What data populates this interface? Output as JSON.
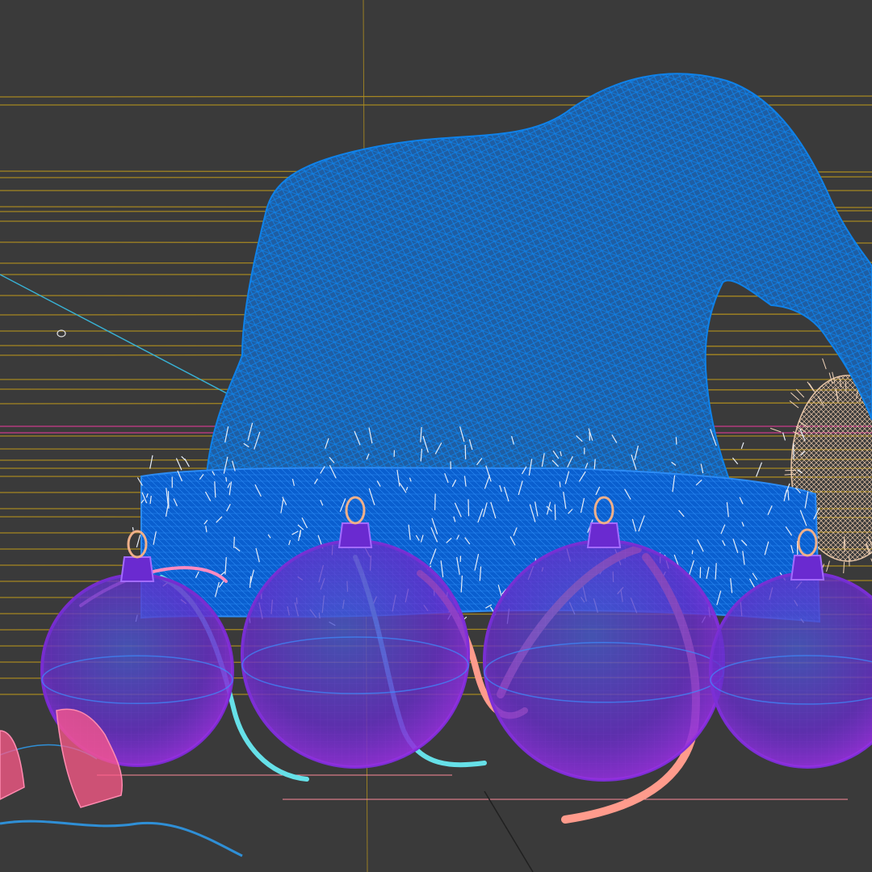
{
  "viewport": {
    "view_mode": "wireframe",
    "background_color": "#3a3a3a"
  },
  "scene": {
    "objects": [
      {
        "name": "santa-hat",
        "color": "#0a63c8"
      },
      {
        "name": "hat-fur-brim",
        "color": "#0a5fcf"
      },
      {
        "name": "ornament-ball-1",
        "color": "#7a2ccf"
      },
      {
        "name": "ornament-ball-2",
        "color": "#7b2fd4"
      },
      {
        "name": "ornament-ball-3",
        "color": "#7b2fd4"
      },
      {
        "name": "ornament-ball-4",
        "color": "#7b2fd4"
      },
      {
        "name": "ornament-ribbons",
        "color": "#ff9b8c"
      },
      {
        "name": "pine-cone-right",
        "color": "#e8c6a8"
      },
      {
        "name": "string-lights",
        "color": "#ff5a8a"
      }
    ],
    "guide_colors": {
      "horizontal_lines": "#b18f1f",
      "magenta_lines": "#c93a8b",
      "cyan_line": "#38b3d6",
      "pink_lines": "#ff8a9a"
    }
  }
}
